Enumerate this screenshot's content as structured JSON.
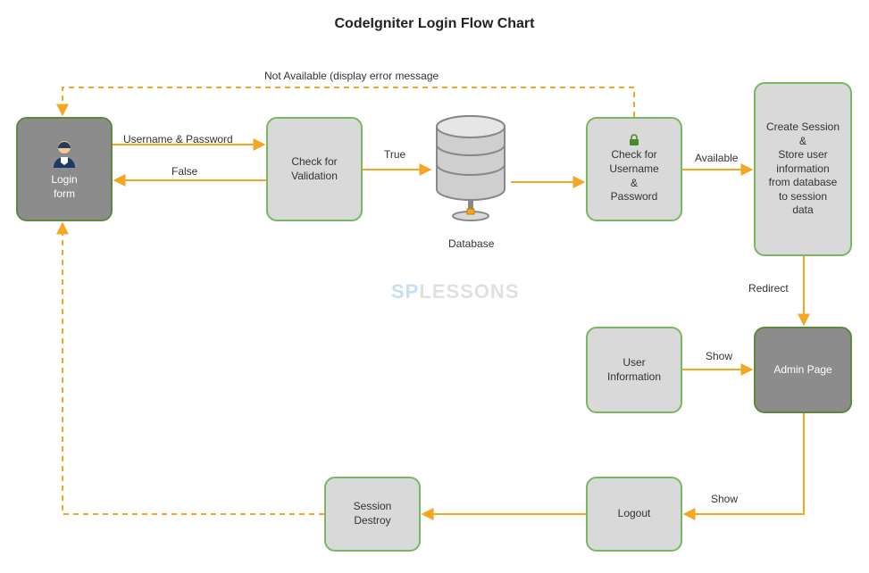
{
  "title": "CodeIgniter Login Flow Chart",
  "nodes": {
    "login_form": "Login\nform",
    "check_validation": "Check for\nValidation",
    "database": "Database",
    "check_user_pass": "Check for\nUsername\n&\nPassword",
    "create_session": "Create Session\n&\nStore user\ninformation\nfrom database\nto session\ndata",
    "user_information": "User\nInformation",
    "admin_page": "Admin Page",
    "logout": "Logout",
    "session_destroy": "Session\nDestroy"
  },
  "edges": {
    "username_password": "Username & Password",
    "false": "False",
    "true": "True",
    "available": "Available",
    "not_available": "Not Available (display error message",
    "redirect": "Redirect",
    "show1": "Show",
    "show2": "Show"
  },
  "watermark": "SPLESSONS"
}
